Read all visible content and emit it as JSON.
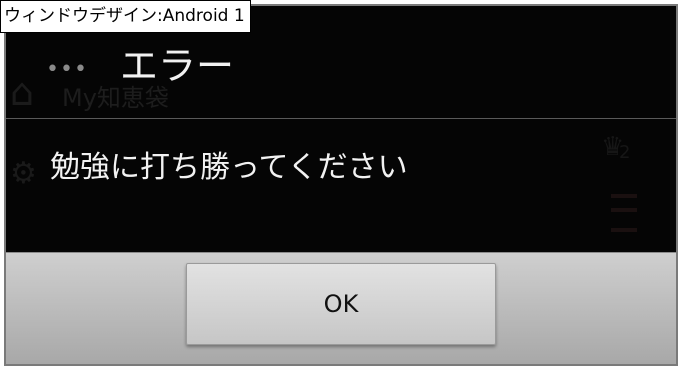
{
  "caption": "ウィンドウデザイン:Android 1",
  "background_app": {
    "title": "My知恵袋",
    "badge_number": "2"
  },
  "dialog": {
    "title": "エラー",
    "message": "勉強に打ち勝ってください",
    "ok_label": "OK"
  },
  "colors": {
    "dialog_background": "#000000",
    "button_bar": "#b8b8b8",
    "text": "#f2f2f2"
  }
}
